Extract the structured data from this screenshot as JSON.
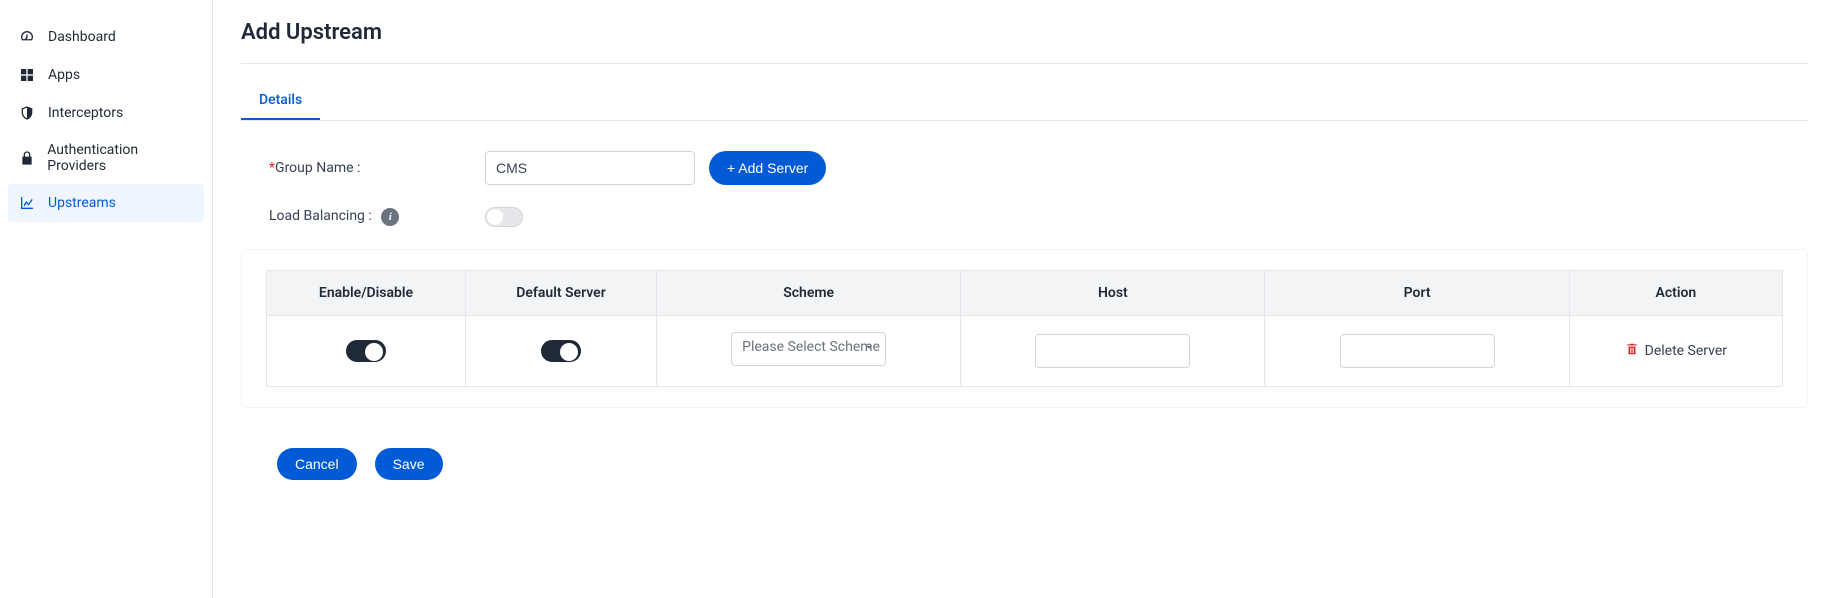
{
  "sidebar": {
    "items": [
      {
        "label": "Dashboard"
      },
      {
        "label": "Apps"
      },
      {
        "label": "Interceptors"
      },
      {
        "label": "Authentication Providers"
      },
      {
        "label": "Upstreams"
      }
    ]
  },
  "page": {
    "title": "Add Upstream"
  },
  "tabs": [
    {
      "label": "Details"
    }
  ],
  "form": {
    "group_name_label": "Group Name :",
    "group_name_value": "CMS",
    "add_server_label": "+ Add Server",
    "load_balancing_label": "Load Balancing :",
    "info_char": "i"
  },
  "table": {
    "headers": {
      "enable": "Enable/Disable",
      "default": "Default Server",
      "scheme": "Scheme",
      "host": "Host",
      "port": "Port",
      "action": "Action"
    },
    "row": {
      "scheme_placeholder": "Please Select Scheme",
      "host_value": "",
      "port_value": "",
      "delete_label": "Delete Server"
    }
  },
  "actions": {
    "cancel": "Cancel",
    "save": "Save"
  }
}
